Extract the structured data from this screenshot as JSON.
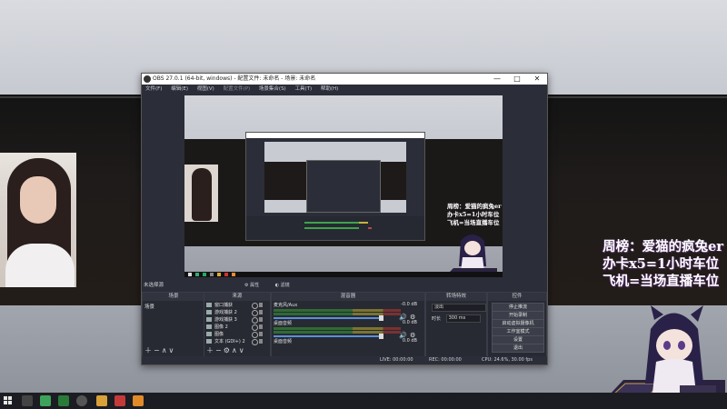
{
  "window": {
    "title": "OBS 27.0.1 (64-bit, windows) - 配置文件: 未命名 - 场景: 未命名",
    "minimize": "—",
    "maximize": "□",
    "close": "✕"
  },
  "menu": [
    "文件(F)",
    "编辑(E)",
    "视图(V)",
    "配置文件(P)",
    "场景集合(S)",
    "工具(T)",
    "帮助(H)"
  ],
  "overlay_lines": [
    "周榜：爱猫的疯兔er",
    "办卡x5=1小时车位",
    "飞机=当场直播车位"
  ],
  "preview_overlay_lines": [
    "周榜：爱猫的疯兔er",
    "办卡x5=1小时车位",
    "飞机=当场直播车位"
  ],
  "toolbar": {
    "no_source": "未选择源",
    "properties": "属性",
    "filters": "滤镜"
  },
  "docks": {
    "scenes": "场景",
    "sources": "来源",
    "mixer": "混音器",
    "transitions": "转场特效",
    "controls": "控件"
  },
  "scenes": [
    "场景"
  ],
  "sources": [
    {
      "label": "窗口捕获"
    },
    {
      "label": "游戏捕获 2"
    },
    {
      "label": "游戏捕获 3"
    },
    {
      "label": "图像 2"
    },
    {
      "label": "图像"
    },
    {
      "label": "文本 (GDI+) 2"
    }
  ],
  "mixer": [
    {
      "name": "麦克风/Aux",
      "db": "-0.0 dB"
    },
    {
      "name": "桌面音频",
      "db": "0.0 dB"
    },
    {
      "name": "桌面音频",
      "db": "0.0 dB"
    }
  ],
  "transitions": {
    "selected": "淡出",
    "duration_label": "时长",
    "duration_value": "300 ms"
  },
  "controls": [
    "停止推流",
    "开始录制",
    "启动虚拟摄像机",
    "工作室模式",
    "设置",
    "退出"
  ],
  "status": {
    "live": "LIVE: 00:00:00",
    "rec": "REC: 00:00:00",
    "cpu": "CPU: 24.6%, 30.00 fps"
  },
  "colors": {
    "obs_bg": "#2b2e38",
    "dock_bg": "#272a33",
    "meter_green": "#2f6b33",
    "meter_yellow": "#7a7431",
    "meter_red": "#7a3131",
    "slider_blue": "#5b8fd6"
  }
}
